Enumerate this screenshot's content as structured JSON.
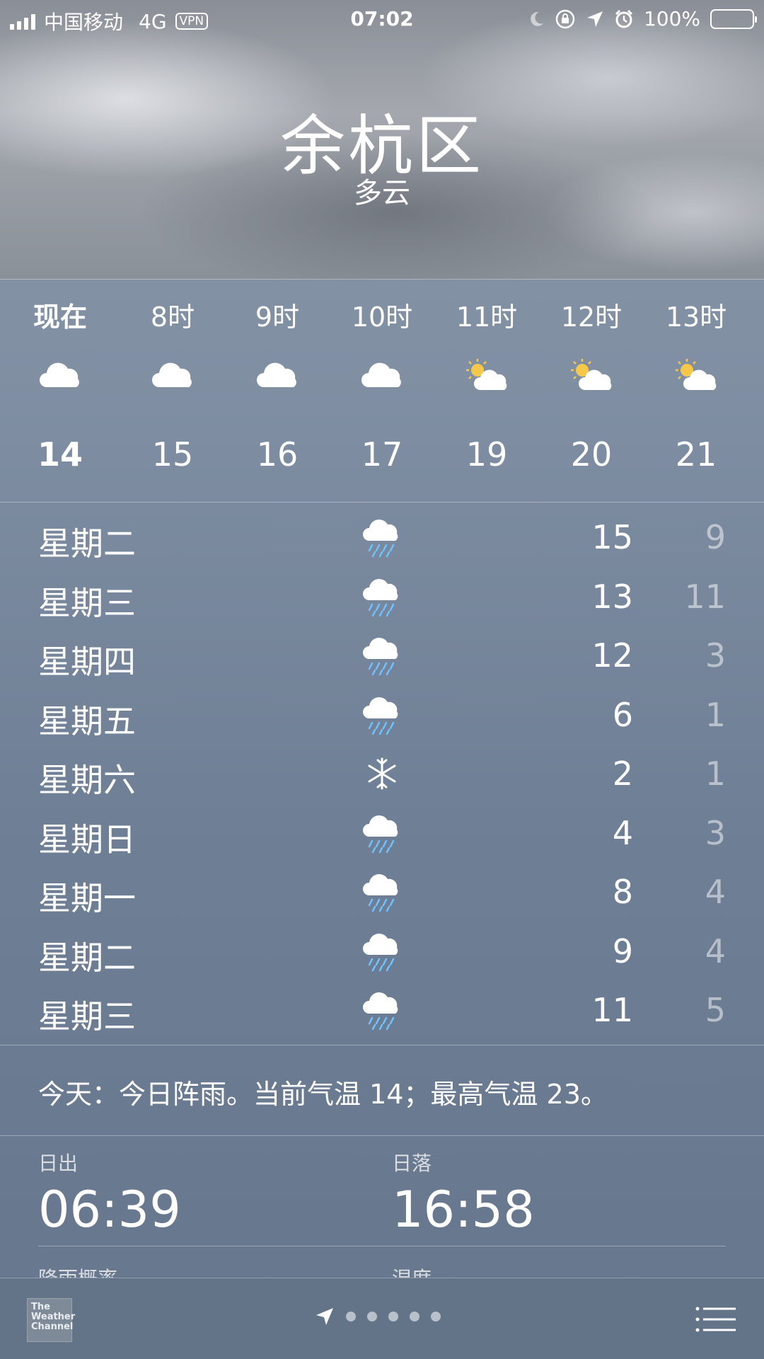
{
  "status_bar": {
    "carrier": "中国移动",
    "network": "4G",
    "vpn": "VPN",
    "time": "07:02",
    "battery": "100%",
    "battery_level": 1.0
  },
  "location": {
    "city": "余杭区",
    "condition": "多云"
  },
  "hourly": [
    {
      "label": "现在",
      "icon": "cloud-icon",
      "temp": "14"
    },
    {
      "label": "8时",
      "icon": "cloud-icon",
      "temp": "15"
    },
    {
      "label": "9时",
      "icon": "cloud-icon",
      "temp": "16"
    },
    {
      "label": "10时",
      "icon": "cloud-icon",
      "temp": "17"
    },
    {
      "label": "11时",
      "icon": "partly-sunny-icon",
      "temp": "19"
    },
    {
      "label": "12时",
      "icon": "partly-sunny-icon",
      "temp": "20"
    },
    {
      "label": "13时",
      "icon": "partly-sunny-icon",
      "temp": "21"
    }
  ],
  "daily": [
    {
      "day": "星期二",
      "icon": "rain-icon",
      "high": "15",
      "low": "9"
    },
    {
      "day": "星期三",
      "icon": "rain-icon",
      "high": "13",
      "low": "11"
    },
    {
      "day": "星期四",
      "icon": "rain-icon",
      "high": "12",
      "low": "3"
    },
    {
      "day": "星期五",
      "icon": "rain-icon",
      "high": "6",
      "low": "1"
    },
    {
      "day": "星期六",
      "icon": "snow-icon",
      "high": "2",
      "low": "1"
    },
    {
      "day": "星期日",
      "icon": "rain-icon",
      "high": "4",
      "low": "3"
    },
    {
      "day": "星期一",
      "icon": "rain-icon",
      "high": "8",
      "low": "4"
    },
    {
      "day": "星期二",
      "icon": "rain-icon",
      "high": "9",
      "low": "4"
    },
    {
      "day": "星期三",
      "icon": "rain-icon",
      "high": "11",
      "low": "5"
    }
  ],
  "summary": "今天：今日阵雨。当前气温 14；最高气温 23。",
  "details": {
    "sunrise_label": "日出",
    "sunrise": "06:39",
    "sunset_label": "日落",
    "sunset": "16:58",
    "rain_chance_label": "降雨概率",
    "humidity_label": "湿度"
  },
  "toolbar": {
    "brand_line1": "The",
    "brand_line2": "Weather",
    "brand_line3": "Channel",
    "page_count": 5
  },
  "colors": {
    "rain_drops": "#6fc3ff",
    "sun": "#f6c84a",
    "low_temp": "rgba(255,255,255,0.5)"
  }
}
